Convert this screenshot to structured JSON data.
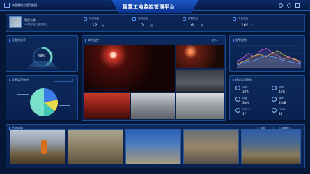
{
  "header": {
    "logo_text": "中国铁建工程局集团",
    "title": "智慧工地监控管理平台"
  },
  "project": {
    "name": "项目名称",
    "desc": "XX项目施工监控中心"
  },
  "stats": [
    {
      "label": "在线设备",
      "value": "12",
      "unit": "台"
    },
    {
      "label": "离线设备",
      "value": "0",
      "unit": "台"
    },
    {
      "label": "报警数量",
      "value": "6",
      "unit": "条"
    },
    {
      "label": "今日温度",
      "value": "10°",
      "unit": "C"
    }
  ],
  "panels": {
    "online_rate": "设备在线率",
    "device_type": "设备类型统计",
    "live_video": "实时监控",
    "alarm_trend": "报警趋势",
    "environment": "环境监测数据",
    "snapshots": "监控抓拍"
  },
  "gauge": {
    "percent": 43,
    "label": "43%"
  },
  "pie": {
    "slices": [
      {
        "value": 22,
        "color": "#3d7de6"
      },
      {
        "value": 14,
        "color": "#e8d94c"
      },
      {
        "value": 14,
        "color": "#43c6b6"
      },
      {
        "value": 50,
        "color": "#7be0c9"
      }
    ]
  },
  "chart_data": {
    "type": "line",
    "x": [
      1,
      2,
      3,
      4,
      5,
      6,
      7,
      8,
      9,
      10,
      11,
      12
    ],
    "series": [
      {
        "values": [
          5,
          8,
          12,
          9,
          14,
          16,
          13,
          10,
          7,
          9,
          6,
          4
        ],
        "color": "#d35bd6"
      },
      {
        "values": [
          3,
          5,
          7,
          10,
          11,
          9,
          12,
          14,
          11,
          8,
          7,
          5
        ],
        "color": "#e8c24c"
      },
      {
        "values": [
          2,
          4,
          5,
          6,
          8,
          10,
          9,
          8,
          6,
          5,
          4,
          3
        ],
        "color": "#5aa8ff"
      }
    ],
    "ylim": [
      0,
      18
    ]
  },
  "env": [
    {
      "icon": "temp-icon",
      "label": "温度",
      "value": "10°C"
    },
    {
      "icon": "humidity-icon",
      "label": "湿度",
      "value": "45%"
    },
    {
      "icon": "wind-icon",
      "label": "风速",
      "value": "3m/s"
    },
    {
      "icon": "noise-icon",
      "label": "噪声",
      "value": "52dB"
    },
    {
      "icon": "dust-icon",
      "label": "PM2.5",
      "value": "17"
    },
    {
      "icon": "cloud-icon",
      "label": "PM10",
      "value": "33"
    }
  ],
  "snapshot_controls": {
    "filter": "全部",
    "more": "查看更多"
  },
  "live_more": "更多>"
}
